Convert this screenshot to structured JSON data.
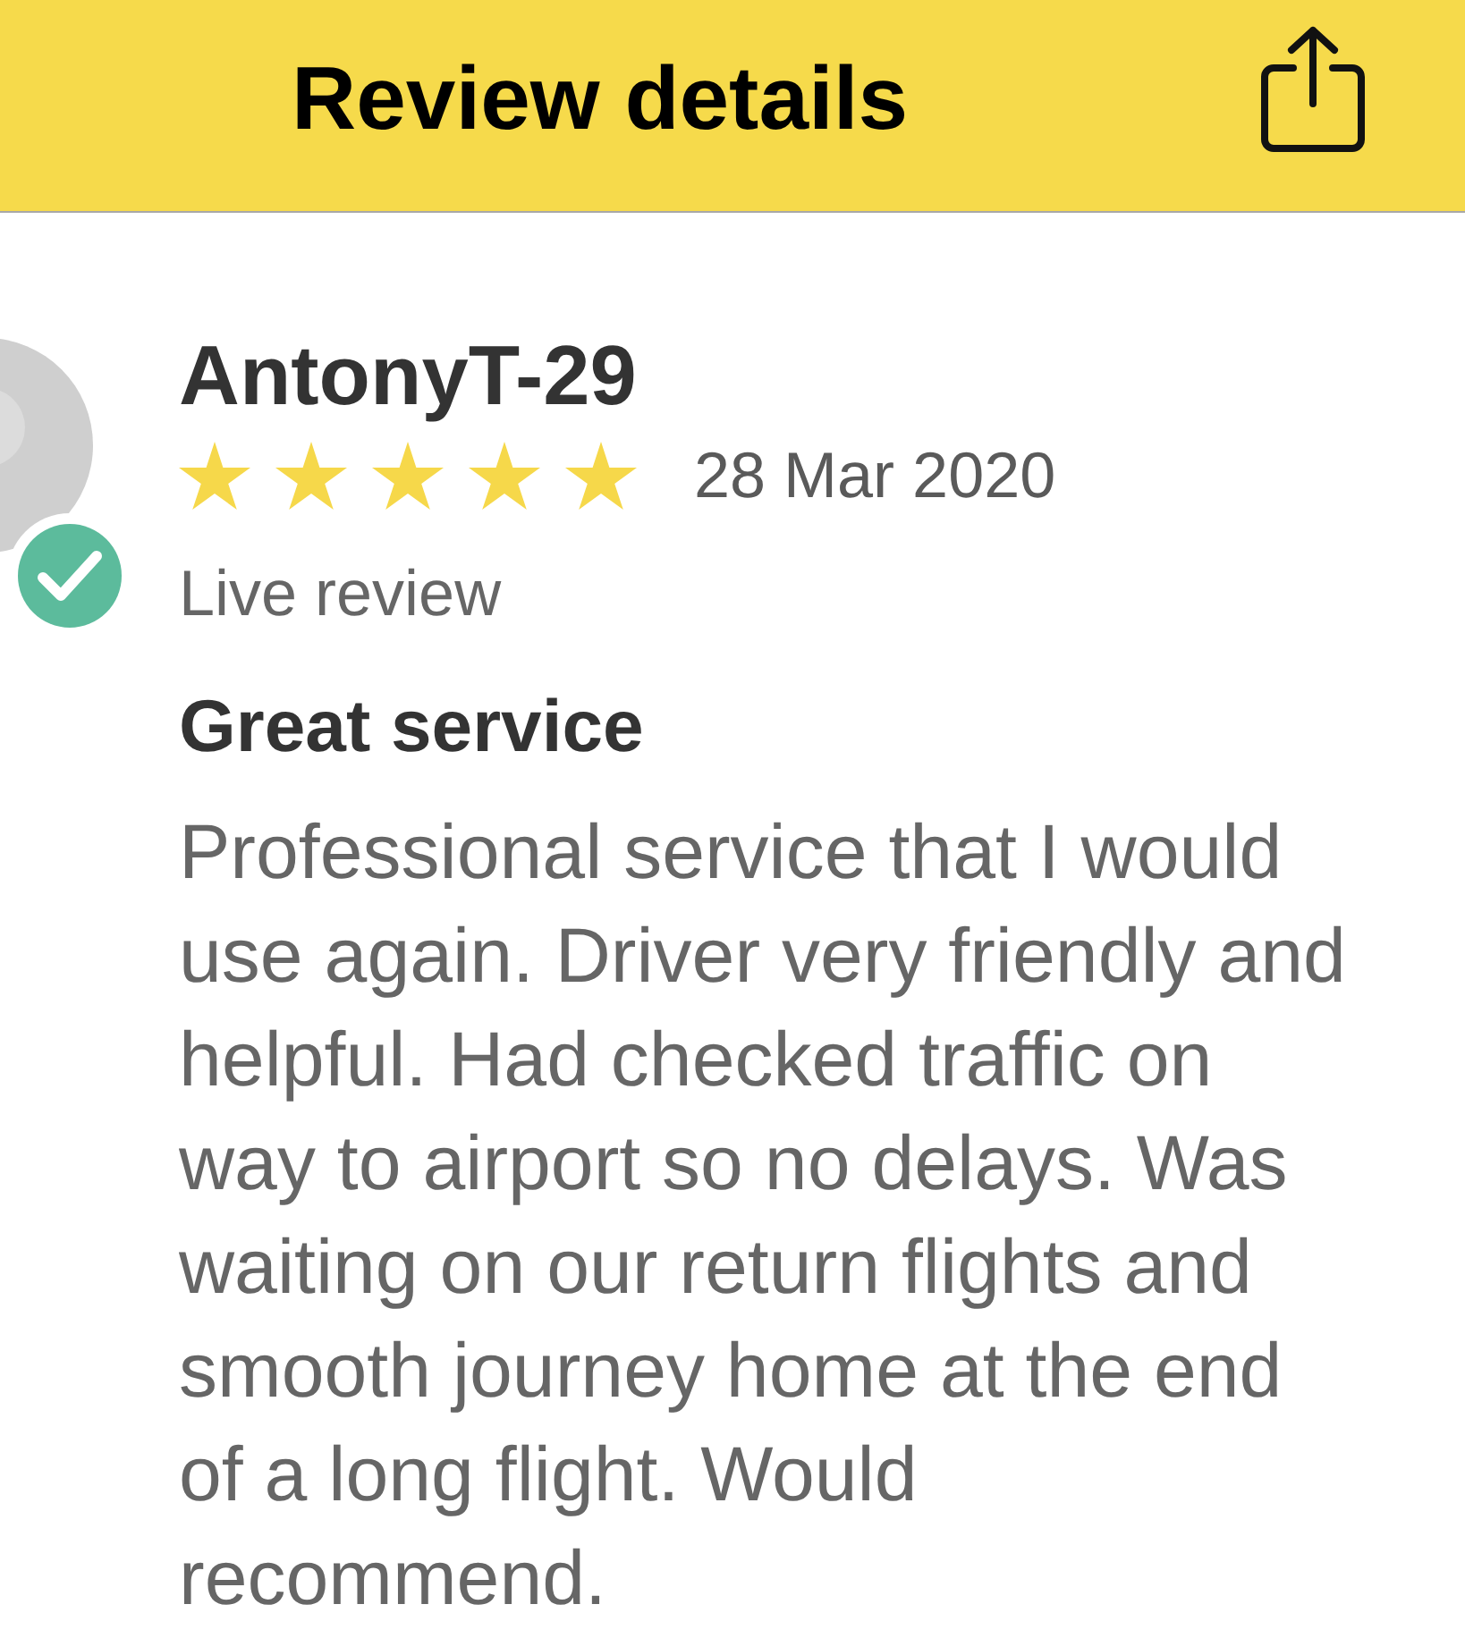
{
  "header": {
    "title": "Review details"
  },
  "review": {
    "reviewer": "AntonyT-29",
    "verified": true,
    "stars": 5,
    "date": "28 Mar 2020",
    "status": "Live review",
    "title": "Great service",
    "body": "Professional service that I would use again. Driver very friendly and helpful. Had checked traffic on way to airport so no delays. Was waiting on our return flights and smooth journey home at the end of a long flight. Would recommend."
  }
}
